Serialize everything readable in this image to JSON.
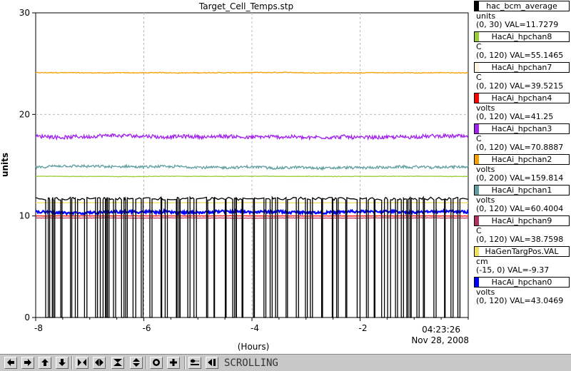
{
  "chart_data": {
    "type": "line",
    "title": "Target_Cell_Temps.stp",
    "xlabel": "(Hours)",
    "ylabel": "units",
    "xlim": [
      -8,
      0
    ],
    "ylim": [
      0,
      30
    ],
    "x_ticks": [
      "-8",
      "-6",
      "-4",
      "-2"
    ],
    "y_ticks": [
      "0",
      "10",
      "20",
      "30"
    ],
    "grid": true,
    "time_label": "04:23:26",
    "date_label": "Nov 28, 2008",
    "series": [
      {
        "name": "HacAi_hpchan2",
        "color": "#f5a000",
        "level": 24.1,
        "noise": 0.08
      },
      {
        "name": "HacAi_hpchan3",
        "color": "#a020f0",
        "level": 17.8,
        "noise": 0.35
      },
      {
        "name": "HacAi_hpchan1",
        "color": "#5f9ea0",
        "level": 14.8,
        "noise": 0.25
      },
      {
        "name": "HacAi_hpchan8",
        "color": "#9acd32",
        "level": 13.9,
        "noise": 0.05
      },
      {
        "name": "HaGenTargPos.VAL",
        "color": "#f0e060",
        "level": 11.3,
        "noise": 0.03
      },
      {
        "name": "HacAi_hpchan9",
        "color": "#b03060",
        "level": 9.8,
        "noise": 0.03
      },
      {
        "name": "HacAi_hpchan4",
        "color": "#ff0000",
        "level": 10.0,
        "noise": 0.03
      },
      {
        "name": "HacAi_hpchan0",
        "color": "#0000ff",
        "level": 10.4,
        "noise": 0.25
      },
      {
        "name": "hac_bcm_average",
        "color": "#000000",
        "level": 11.7,
        "noise": 0.3
      }
    ]
  },
  "legend": [
    {
      "name": "hac_bcm_average",
      "color": "#000000",
      "units": "units",
      "range_val": "(0, 30) VAL=11.7279"
    },
    {
      "name": "HacAi_hpchan8",
      "color": "#9acd32",
      "units": "C",
      "range_val": "(0, 120) VAL=55.1465"
    },
    {
      "name": "HacAi_hpchan7",
      "color": "#fff3e0",
      "units": "C",
      "range_val": "(0, 120) VAL=39.5215"
    },
    {
      "name": "HacAi_hpchan4",
      "color": "#ff0000",
      "units": "volts",
      "range_val": "(0, 120) VAL=41.25"
    },
    {
      "name": "HacAi_hpchan3",
      "color": "#a020f0",
      "units": "C",
      "range_val": "(0, 120) VAL=70.8887"
    },
    {
      "name": "HacAi_hpchan2",
      "color": "#f5a000",
      "units": "volts",
      "range_val": "(0, 200) VAL=159.814"
    },
    {
      "name": "HacAi_hpchan1",
      "color": "#5f9ea0",
      "units": "volts",
      "range_val": "(0, 120) VAL=60.4004"
    },
    {
      "name": "HacAi_hpchan9",
      "color": "#b03060",
      "units": "C",
      "range_val": "(0, 120) VAL=38.7598"
    },
    {
      "name": "HaGenTargPos.VAL",
      "color": "#f0e060",
      "units": "cm",
      "range_val": "(-15, 0) VAL=-9.37"
    },
    {
      "name": "HacAi_hpchan0",
      "color": "#0000ff",
      "units": "volts",
      "range_val": "(0, 120) VAL=43.0469"
    }
  ],
  "toolbar": {
    "buttons": [
      {
        "name": "pan-left-button",
        "icon": "arrow-left-icon"
      },
      {
        "name": "pan-right-button",
        "icon": "arrow-right-icon"
      },
      {
        "name": "pan-up-button",
        "icon": "arrow-up-icon"
      },
      {
        "name": "pan-down-button",
        "icon": "arrow-down-icon"
      },
      {
        "name": "zoom-in-x-button",
        "icon": "zoom-in-x-icon"
      },
      {
        "name": "zoom-out-x-button",
        "icon": "zoom-out-x-icon"
      },
      {
        "name": "zoom-in-y-button",
        "icon": "zoom-in-y-icon"
      },
      {
        "name": "zoom-out-y-button",
        "icon": "zoom-out-y-icon"
      },
      {
        "name": "zoom-box-button",
        "icon": "circle-icon"
      },
      {
        "name": "crosshair-button",
        "icon": "crosshair-icon"
      },
      {
        "name": "auto-scale-button",
        "icon": "autoscale-icon"
      },
      {
        "name": "back-button",
        "icon": "arrow-left-bar-icon"
      }
    ],
    "status": "SCROLLING"
  }
}
